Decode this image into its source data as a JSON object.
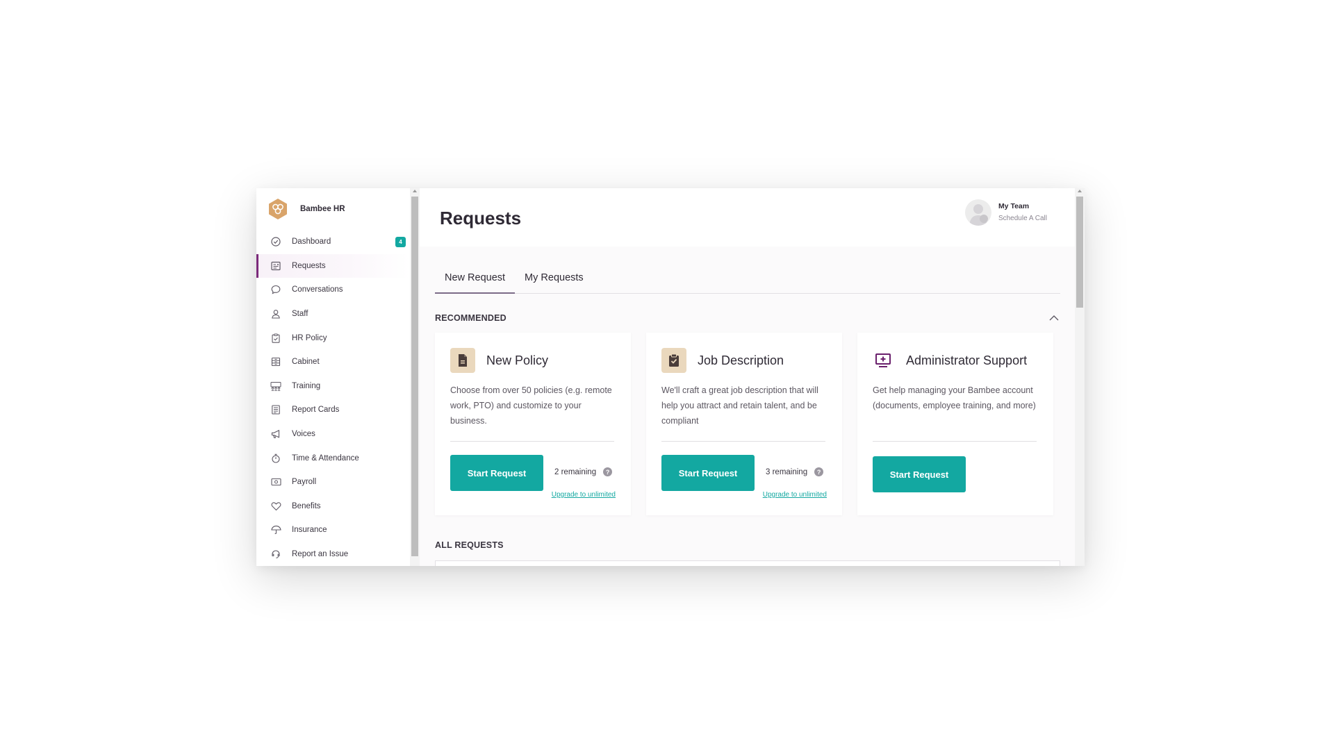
{
  "brand": {
    "name": "Bambee HR",
    "logo_icon": "bambee-hexagon-logo",
    "color": "#d9a46a"
  },
  "sidebar": {
    "items": [
      {
        "label": "Dashboard",
        "icon": "check-circle-icon",
        "badge": "4"
      },
      {
        "label": "Requests",
        "icon": "requests-icon",
        "active": true
      },
      {
        "label": "Conversations",
        "icon": "chat-bubble-icon"
      },
      {
        "label": "Staff",
        "icon": "person-icon"
      },
      {
        "label": "HR Policy",
        "icon": "clipboard-icon"
      },
      {
        "label": "Cabinet",
        "icon": "cabinet-icon"
      },
      {
        "label": "Training",
        "icon": "training-icon"
      },
      {
        "label": "Report Cards",
        "icon": "report-card-icon"
      },
      {
        "label": "Voices",
        "icon": "megaphone-icon"
      },
      {
        "label": "Time & Attendance",
        "icon": "stopwatch-icon"
      },
      {
        "label": "Payroll",
        "icon": "payroll-icon"
      },
      {
        "label": "Benefits",
        "icon": "heart-icon"
      },
      {
        "label": "Insurance",
        "icon": "umbrella-icon"
      },
      {
        "label": "Report an Issue",
        "icon": "report-issue-icon"
      }
    ]
  },
  "header": {
    "title": "Requests",
    "team": {
      "name": "My Team",
      "link": "Schedule A Call"
    }
  },
  "tabs": [
    {
      "label": "New Request",
      "active": true
    },
    {
      "label": "My Requests",
      "active": false
    }
  ],
  "sections": {
    "recommended": "RECOMMENDED",
    "all_requests": "ALL REQUESTS"
  },
  "cards": [
    {
      "title": "New Policy",
      "icon": "document-icon",
      "description": "Choose from over 50 policies (e.g. remote work, PTO) and customize to your business.",
      "button": "Start Request",
      "remaining": "2 remaining",
      "upgrade": "Upgrade to unlimited"
    },
    {
      "title": "Job Description",
      "icon": "clipboard-check-icon",
      "description": "We'll craft a great job description that will help you attract and retain talent, and be compliant",
      "button": "Start Request",
      "remaining": "3 remaining",
      "upgrade": "Upgrade to unlimited"
    },
    {
      "title": "Administrator Support",
      "icon": "admin-monitor-icon",
      "description": "Get help managing your Bambee account (documents, employee training, and more)",
      "button": "Start Request"
    }
  ],
  "colors": {
    "accent": "#13a8a1",
    "active_nav": "#7b2a7a",
    "tan": "#ead8bd",
    "purple_icon": "#6a1f6c"
  }
}
